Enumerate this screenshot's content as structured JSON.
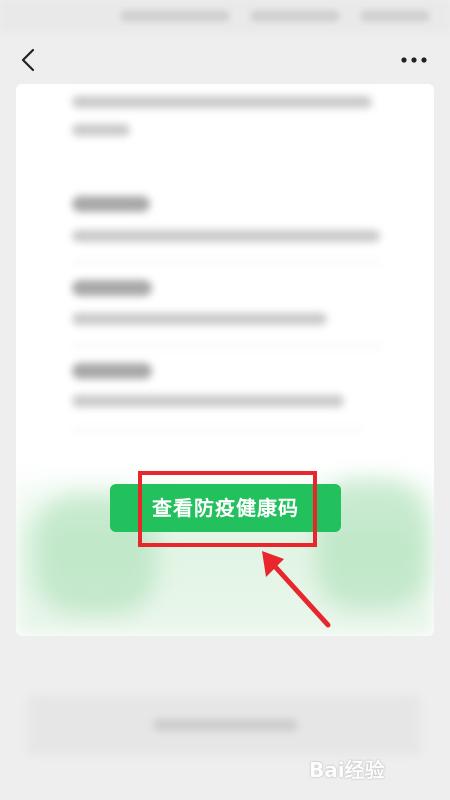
{
  "main": {
    "primary_button_label": "查看防疫健康码"
  },
  "watermark": {
    "text": "Bai经验"
  },
  "colors": {
    "primary_green": "#23c05e",
    "annotation_red": "#e8262b"
  },
  "icons": {
    "back": "chevron-left-icon",
    "more": "more-dots-icon",
    "annotation_arrow": "arrow-icon"
  }
}
